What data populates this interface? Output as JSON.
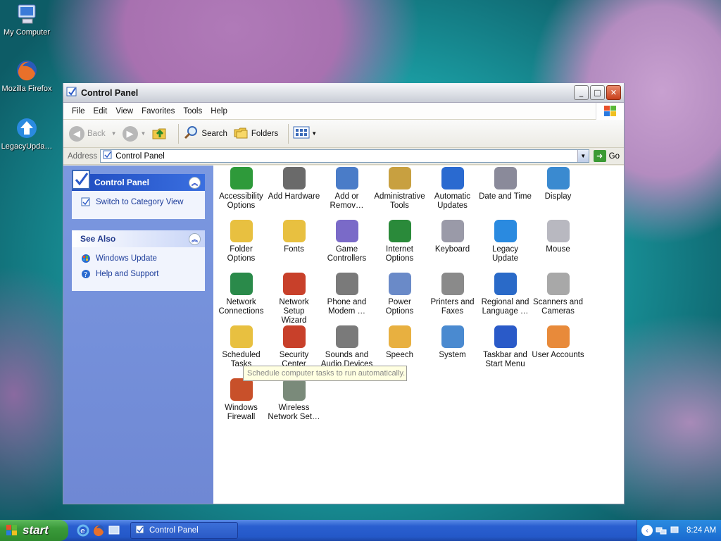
{
  "desktop": {
    "icons": [
      {
        "label": "My Computer",
        "icon": "my-computer-icon"
      },
      {
        "label": "Mozilla Firefox",
        "icon": "firefox-icon"
      },
      {
        "label": "LegacyUpda…",
        "icon": "legacy-update-icon"
      }
    ]
  },
  "window": {
    "title": "Control Panel",
    "menu": [
      "File",
      "Edit",
      "View",
      "Favorites",
      "Tools",
      "Help"
    ],
    "toolbar": {
      "back": "Back",
      "search": "Search",
      "folders": "Folders"
    },
    "address": {
      "label": "Address",
      "value": "Control Panel",
      "go": "Go"
    }
  },
  "taskpane": {
    "control_panel": {
      "title": "Control Panel",
      "link": "Switch to Category View"
    },
    "see_also": {
      "title": "See Also",
      "links": [
        "Windows Update",
        "Help and Support"
      ]
    }
  },
  "items": [
    {
      "l1": "Accessibility",
      "l2": "Options",
      "icon": "accessibility-icon",
      "color": "#2e9a3a"
    },
    {
      "l1": "Add Hardware",
      "l2": "",
      "icon": "add-hardware-icon",
      "color": "#6a6a6a"
    },
    {
      "l1": "Add or",
      "l2": "Remov…",
      "icon": "add-remove-programs-icon",
      "color": "#4a7cc8"
    },
    {
      "l1": "Administrative",
      "l2": "Tools",
      "icon": "administrative-tools-icon",
      "color": "#c8a040"
    },
    {
      "l1": "Automatic",
      "l2": "Updates",
      "icon": "automatic-updates-icon",
      "color": "#2a6ad0"
    },
    {
      "l1": "Date and Time",
      "l2": "",
      "icon": "date-time-icon",
      "color": "#8a8a9a"
    },
    {
      "l1": "Display",
      "l2": "",
      "icon": "display-icon",
      "color": "#3a8ad0"
    },
    {
      "l1": "Folder Options",
      "l2": "",
      "icon": "folder-options-icon",
      "color": "#e8c040"
    },
    {
      "l1": "Fonts",
      "l2": "",
      "icon": "fonts-icon",
      "color": "#e8c040"
    },
    {
      "l1": "Game",
      "l2": "Controllers",
      "icon": "game-controllers-icon",
      "color": "#7a6ac8"
    },
    {
      "l1": "Internet",
      "l2": "Options",
      "icon": "internet-options-icon",
      "color": "#2a8a3a"
    },
    {
      "l1": "Keyboard",
      "l2": "",
      "icon": "keyboard-icon",
      "color": "#9a9aa8"
    },
    {
      "l1": "Legacy",
      "l2": "Update",
      "icon": "legacy-update-icon",
      "color": "#2a8ae0"
    },
    {
      "l1": "Mouse",
      "l2": "",
      "icon": "mouse-icon",
      "color": "#b8b8c0"
    },
    {
      "l1": "Network",
      "l2": "Connections",
      "icon": "network-connections-icon",
      "color": "#2a8a4a"
    },
    {
      "l1": "Network Setup",
      "l2": "Wizard",
      "icon": "network-setup-wizard-icon",
      "color": "#c8402a"
    },
    {
      "l1": "Phone and",
      "l2": "Modem …",
      "icon": "phone-modem-icon",
      "color": "#7a7a7a"
    },
    {
      "l1": "Power Options",
      "l2": "",
      "icon": "power-options-icon",
      "color": "#6a8ac8"
    },
    {
      "l1": "Printers and",
      "l2": "Faxes",
      "icon": "printers-faxes-icon",
      "color": "#8a8a8a"
    },
    {
      "l1": "Regional and",
      "l2": "Language …",
      "icon": "regional-language-icon",
      "color": "#2a6ac8"
    },
    {
      "l1": "Scanners and",
      "l2": "Cameras",
      "icon": "scanners-cameras-icon",
      "color": "#a8a8a8"
    },
    {
      "l1": "Scheduled",
      "l2": "Tasks",
      "icon": "scheduled-tasks-icon",
      "color": "#e8c040"
    },
    {
      "l1": "Security",
      "l2": "Center",
      "icon": "security-center-icon",
      "color": "#c8402a"
    },
    {
      "l1": "Sounds and",
      "l2": "Audio Devices",
      "icon": "sounds-audio-icon",
      "color": "#7a7a7a"
    },
    {
      "l1": "Speech",
      "l2": "",
      "icon": "speech-icon",
      "color": "#e8b040"
    },
    {
      "l1": "System",
      "l2": "",
      "icon": "system-icon",
      "color": "#4a8ad0"
    },
    {
      "l1": "Taskbar and",
      "l2": "Start Menu",
      "icon": "taskbar-start-menu-icon",
      "color": "#2a5ac8"
    },
    {
      "l1": "User Accounts",
      "l2": "",
      "icon": "user-accounts-icon",
      "color": "#e88a3a"
    },
    {
      "l1": "Windows",
      "l2": "Firewall",
      "icon": "windows-firewall-icon",
      "color": "#c8502a"
    },
    {
      "l1": "Wireless",
      "l2": "Network Set…",
      "icon": "wireless-network-setup-icon",
      "color": "#7a8a7a"
    }
  ],
  "tooltip": "Schedule computer tasks to run automatically.",
  "taskbar": {
    "start": "start",
    "task": "Control Panel",
    "clock": "8:24 AM"
  }
}
